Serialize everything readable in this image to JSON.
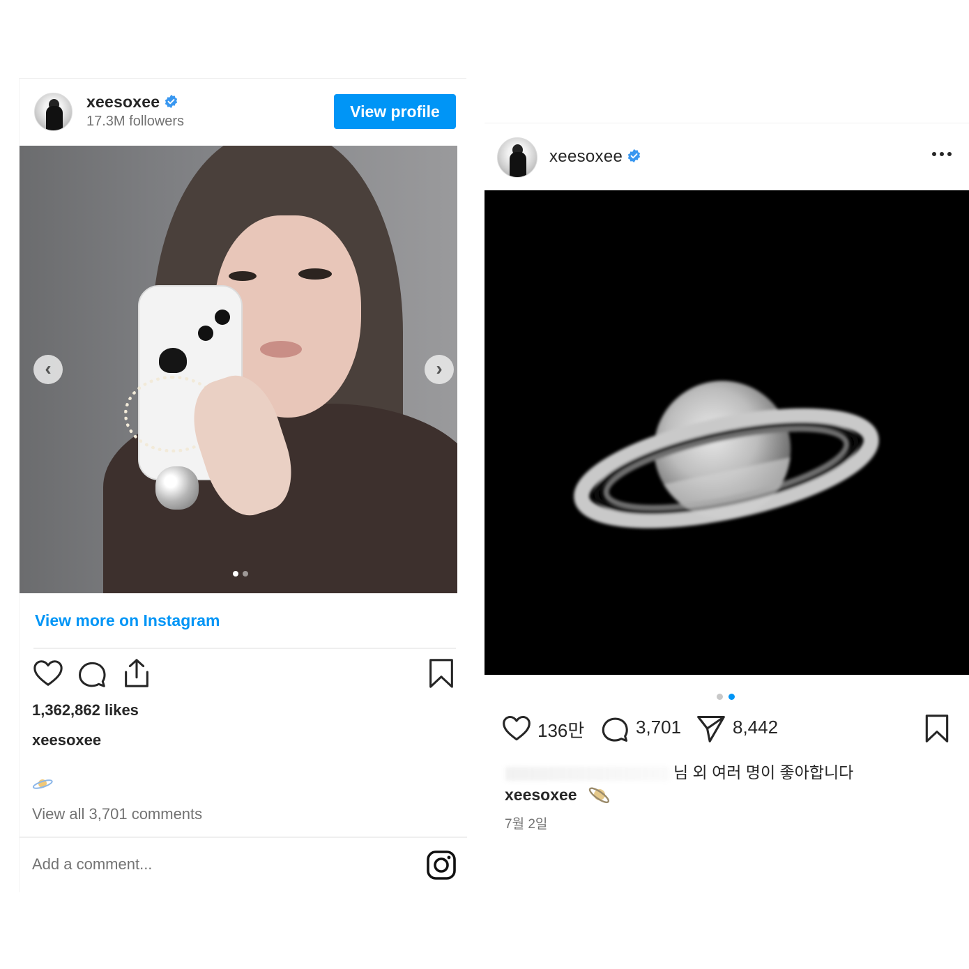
{
  "left_post": {
    "username": "xeesoxee",
    "followers": "17.3M followers",
    "view_profile_label": "View profile",
    "view_more_label": "View more on Instagram",
    "likes": "1,362,862 likes",
    "caption_username": "xeesoxee",
    "caption_emoji_icon": "ringed-planet-icon",
    "view_comments": "View all 3,701 comments",
    "add_comment_placeholder": "Add a comment...",
    "carousel_total": 2,
    "carousel_active": 1
  },
  "right_post": {
    "username": "xeesoxee",
    "like_count": "136만",
    "comment_count": "3,701",
    "share_count": "8,442",
    "liked_by_text": "님 외 여러 명이 좋아합니다",
    "caption_username": "xeesoxee",
    "caption_emoji_icon": "ringed-planet-icon",
    "date": "7월 2일",
    "carousel_total": 2,
    "carousel_active": 2
  },
  "colors": {
    "accent_blue": "#0095f6",
    "text_primary": "#262626",
    "text_secondary": "#737373",
    "dot_inactive": "#c8c8c8",
    "verified_blue": "#3897f0"
  }
}
